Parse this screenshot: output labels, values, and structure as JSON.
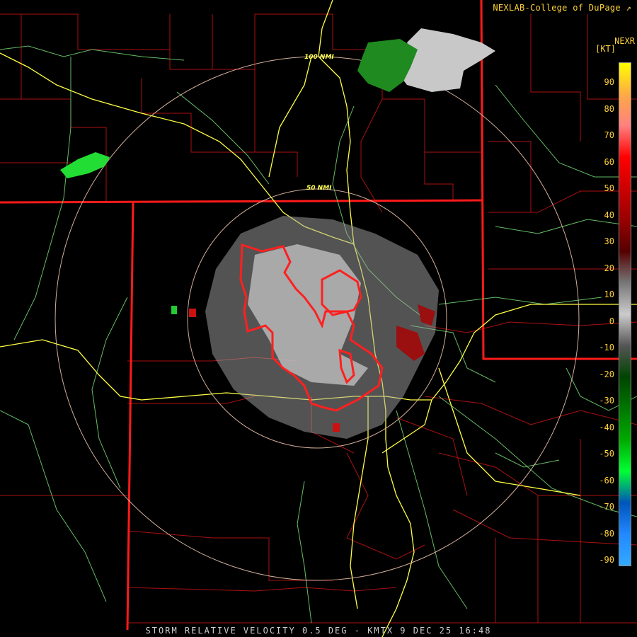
{
  "header": {
    "credit": "NEXLAB-College of DuPage",
    "credit_icon": "external-link-icon",
    "product_code": "NEXR",
    "unit": "[KT]"
  },
  "legend": {
    "ticks": [
      "90",
      "80",
      "70",
      "60",
      "50",
      "40",
      "30",
      "20",
      "10",
      "0",
      "-10",
      "-20",
      "-30",
      "-40",
      "-50",
      "-60",
      "-70",
      "-80",
      "-90"
    ],
    "gradient_stops": [
      "#ffff00",
      "#ffaa44",
      "#ff8080",
      "#ff0000",
      "#cc0000",
      "#990000",
      "#550000",
      "#777777",
      "#cccccc",
      "#555555",
      "#004400",
      "#007700",
      "#00aa00",
      "#00ff33",
      "#0055bb",
      "#2288ff",
      "#33aaff"
    ]
  },
  "rings": [
    {
      "label": "100 NMI"
    },
    {
      "label": "50 NMI"
    }
  ],
  "colors": {
    "state_border": "#ff1a1a",
    "county": "#aa1111",
    "highway": "#ffff44",
    "river": "#80e080",
    "ring": "#f0c8b0",
    "warning": "#ff2020"
  },
  "footer": {
    "text": "STORM RELATIVE VELOCITY 0.5 DEG - KMTX 9 DEC 25 16:48"
  }
}
